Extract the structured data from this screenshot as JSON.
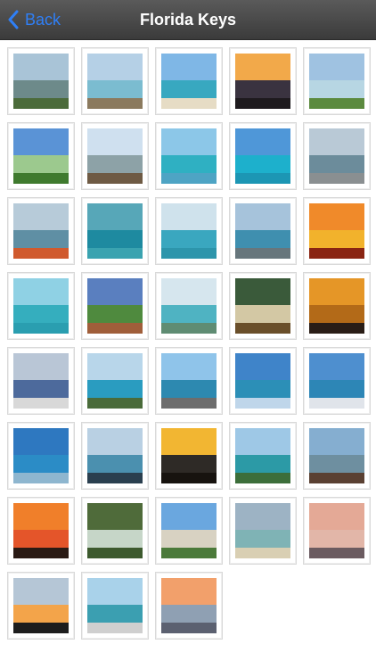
{
  "nav": {
    "back_label": "Back",
    "title": "Florida Keys",
    "accent": "#2f7ff6"
  },
  "gallery": {
    "photos": [
      {
        "sky": "#a9c4d7",
        "sea": "#6d8a8a",
        "land": "#4b6b3a"
      },
      {
        "sky": "#b5d0e6",
        "sea": "#7bbcd0",
        "land": "#8b7a5e"
      },
      {
        "sky": "#7fb7e6",
        "sea": "#38a8c0",
        "land": "#e6dcc5"
      },
      {
        "sky": "#f2a94a",
        "sea": "#3a3340",
        "land": "#1e1a1e"
      },
      {
        "sky": "#9fc2e1",
        "sea": "#b7d6e3",
        "land": "#5b8a3e"
      },
      {
        "sky": "#5a93d6",
        "sea": "#9cc98e",
        "land": "#3f7a2e"
      },
      {
        "sky": "#cfe0ef",
        "sea": "#8da2a7",
        "land": "#6e5a44"
      },
      {
        "sky": "#8cc7e8",
        "sea": "#2fb0c2",
        "land": "#4ea4c4"
      },
      {
        "sky": "#4f97d8",
        "sea": "#1db0cc",
        "land": "#1c96b4"
      },
      {
        "sky": "#b9c9d6",
        "sea": "#6c8c9b",
        "land": "#8a8f91"
      },
      {
        "sky": "#b7cbd9",
        "sea": "#5f8fa4",
        "land": "#d05a2e"
      },
      {
        "sky": "#57a7b8",
        "sea": "#1e8aa0",
        "land": "#3aa3b0"
      },
      {
        "sky": "#cfe2ec",
        "sea": "#3aa7bf",
        "land": "#2d95ab"
      },
      {
        "sky": "#a6c3db",
        "sea": "#3f8faf",
        "land": "#67767c"
      },
      {
        "sky": "#f08a2a",
        "sea": "#f2b22c",
        "land": "#8a2412"
      },
      {
        "sky": "#8fd1e4",
        "sea": "#35aebe",
        "land": "#2a9eb0"
      },
      {
        "sky": "#5a7fbf",
        "sea": "#4f8a3e",
        "land": "#a05e3a"
      },
      {
        "sky": "#d6e6ee",
        "sea": "#4fb3c2",
        "land": "#5f8c73"
      },
      {
        "sky": "#3a5a3a",
        "sea": "#d3c8a4",
        "land": "#6a4f2a"
      },
      {
        "sky": "#e59627",
        "sea": "#b36a18",
        "land": "#2a1d16"
      },
      {
        "sky": "#b9c6d6",
        "sea": "#4d6a9c",
        "land": "#d8d8d8"
      },
      {
        "sky": "#b8d6ea",
        "sea": "#2a9cc0",
        "land": "#4a6b3a"
      },
      {
        "sky": "#8fc4ea",
        "sea": "#2d89b0",
        "land": "#6d6d6d"
      },
      {
        "sky": "#3f84c9",
        "sea": "#2c8fb7",
        "land": "#bfd6ea"
      },
      {
        "sky": "#4e8fcf",
        "sea": "#2d86b6",
        "land": "#e0e4ea"
      },
      {
        "sky": "#2e78c0",
        "sea": "#2b8cc6",
        "land": "#8eb6cf"
      },
      {
        "sky": "#b9d0e3",
        "sea": "#4b90af",
        "land": "#2a3f4f"
      },
      {
        "sky": "#f2b632",
        "sea": "#2e2a26",
        "land": "#17130f"
      },
      {
        "sky": "#9ec8e6",
        "sea": "#2c9aa6",
        "land": "#3c6e3a"
      },
      {
        "sky": "#85aed0",
        "sea": "#6e8fa0",
        "land": "#5a4032"
      },
      {
        "sky": "#f07f2a",
        "sea": "#e4552a",
        "land": "#2a1a14"
      },
      {
        "sky": "#4f6b3a",
        "sea": "#c6d6c8",
        "land": "#3d5a2e"
      },
      {
        "sky": "#6aa7df",
        "sea": "#d8d2c2",
        "land": "#4b7a3a"
      },
      {
        "sky": "#9db3c4",
        "sea": "#7fb3b5",
        "land": "#d9cfb3"
      },
      {
        "sky": "#e4a996",
        "sea": "#e2b6a8",
        "land": "#6b5b60"
      },
      {
        "sky": "#b5c6d6",
        "sea": "#f3a44a",
        "land": "#1d1d1d"
      },
      {
        "sky": "#a9d2ea",
        "sea": "#3b9fb1",
        "land": "#cfcfcf"
      },
      {
        "sky": "#f2a06b",
        "sea": "#8fa0b3",
        "land": "#5b6070"
      }
    ]
  }
}
